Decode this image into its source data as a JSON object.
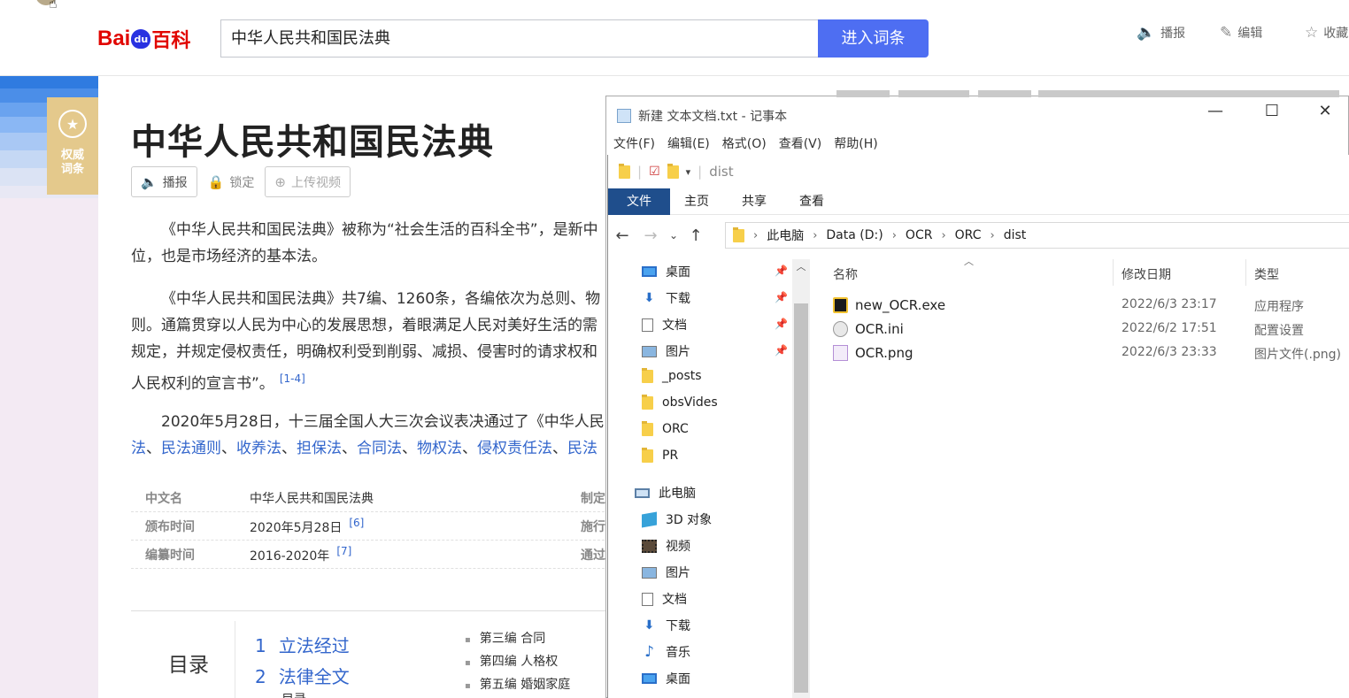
{
  "baidu": {
    "logo_bai": "Bai",
    "logo_du": "du",
    "logo_baike": "百科",
    "search_value": "中华人民共和国民法典",
    "search_button": "进入词条",
    "tools": [
      {
        "icon": "speaker-icon",
        "label": "播报"
      },
      {
        "icon": "pencil-icon",
        "label": "编辑"
      },
      {
        "icon": "star-icon",
        "label": "收藏"
      }
    ]
  },
  "sidebar": {
    "badge_text": "权威词条"
  },
  "article": {
    "title": "中华人民共和国民法典",
    "buttons": {
      "broadcast": "播报",
      "lock": "锁定",
      "upload_video": "上传视频"
    },
    "para1": [
      "《中华人民共和国民法典》被称为“社会生活的百科全书”，是新中",
      "位，也是市场经济的基本法。"
    ],
    "para2": [
      "《中华人民共和国民法典》共7编、1260条，各编依次为总则、物",
      "则。通篇贯穿以人民为中心的发展思想，着眼满足人民对美好生活的需",
      "规定，并规定侵权责任，明确权利受到削弱、减损、侵害时的请求权和",
      "人民权利的宣言书”。"
    ],
    "para2_ref": "[1-4]",
    "para3": "2020年5月28日，十三届全国人大三次会议表决通过了《中华人民",
    "para3_links": [
      "法",
      "民法通则",
      "收养法",
      "担保法",
      "合同法",
      "物权法",
      "侵权责任法",
      "民法"
    ],
    "para3_sep": "、",
    "info": [
      {
        "key": "中文名",
        "value": "中华人民共和国民法典",
        "ref": "",
        "key2": "制定"
      },
      {
        "key": "颁布时间",
        "value": "2020年5月28日",
        "ref": "[6]",
        "key2": "施行"
      },
      {
        "key": "编纂时间",
        "value": "2016-2020年",
        "ref": "[7]",
        "key2": "通过"
      }
    ],
    "toc_title": "目录",
    "toc": [
      {
        "num": "1",
        "label": "立法经过"
      },
      {
        "num": "2",
        "label": "法律全文"
      },
      {
        "num": "",
        "label": "目录"
      }
    ],
    "toc_sub": [
      "第三编 合同",
      "第四编 人格权",
      "第五编 婚姻家庭"
    ]
  },
  "notepad": {
    "title": "新建 文本文档.txt - 记事本",
    "menu": [
      "文件(F)",
      "编辑(E)",
      "格式(O)",
      "查看(V)",
      "帮助(H)"
    ],
    "minimize": "—",
    "maximize": "☐",
    "close": "✕"
  },
  "explorer": {
    "quick_access_title": "dist",
    "ribbon_tabs": [
      "文件",
      "主页",
      "共享",
      "查看"
    ],
    "breadcrumb": [
      "此电脑",
      "Data (D:)",
      "OCR",
      "ORC",
      "dist"
    ],
    "tree": [
      {
        "label": "桌面",
        "icon": "desktop-icon",
        "pinned": true
      },
      {
        "label": "下载",
        "icon": "download-icon",
        "pinned": true
      },
      {
        "label": "文档",
        "icon": "document-icon",
        "pinned": true
      },
      {
        "label": "图片",
        "icon": "picture-icon",
        "pinned": true
      },
      {
        "label": "_posts",
        "icon": "folder-icon",
        "pinned": false
      },
      {
        "label": "obsVides",
        "icon": "folder-icon",
        "pinned": false
      },
      {
        "label": "ORC",
        "icon": "folder-icon",
        "pinned": false
      },
      {
        "label": "PR",
        "icon": "folder-icon",
        "pinned": false
      },
      {
        "label": "此电脑",
        "icon": "computer-icon",
        "pinned": false
      },
      {
        "label": "3D 对象",
        "icon": "3d-objects-icon",
        "pinned": false
      },
      {
        "label": "视频",
        "icon": "video-icon",
        "pinned": false
      },
      {
        "label": "图片",
        "icon": "picture-icon",
        "pinned": false
      },
      {
        "label": "文档",
        "icon": "document-icon",
        "pinned": false
      },
      {
        "label": "下载",
        "icon": "download-icon",
        "pinned": false
      },
      {
        "label": "音乐",
        "icon": "music-icon",
        "pinned": false
      },
      {
        "label": "桌面",
        "icon": "desktop-icon",
        "pinned": false
      }
    ],
    "columns": {
      "name": "名称",
      "date": "修改日期",
      "type": "类型"
    },
    "files": [
      {
        "name": "new_OCR.exe",
        "date": "2022/6/3 23:17",
        "type": "应用程序",
        "icon": "exe-icon"
      },
      {
        "name": "OCR.ini",
        "date": "2022/6/2 17:51",
        "type": "配置设置",
        "icon": "ini-icon"
      },
      {
        "name": "OCR.png",
        "date": "2022/6/3 23:33",
        "type": "图片文件(.png)",
        "icon": "png-icon"
      }
    ]
  },
  "colors": {
    "baidu_blue": "#4e6ef2",
    "baidu_red": "#e10601",
    "link_blue": "#3366cc",
    "ribbon_file_tab": "#1f4e8c",
    "badge_gold": "#e4c98c"
  }
}
